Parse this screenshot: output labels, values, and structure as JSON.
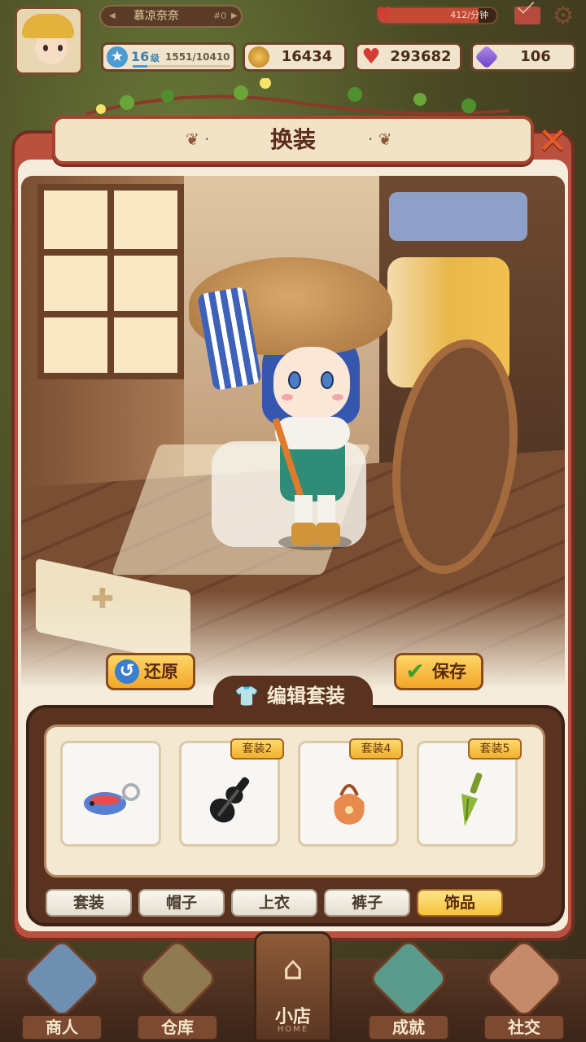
{
  "header": {
    "player_name": "慕凉奈奈",
    "player_uid": "#0",
    "energy_text": "412/分钟",
    "energy_fraction": 0.85,
    "level": "16",
    "level_unit": "级",
    "xp_text": "1551/10410",
    "xp_fraction": 0.149,
    "coins": "16434",
    "hearts": "293682",
    "gems": "106"
  },
  "panel": {
    "title": "换装",
    "close_icon": "close-icon"
  },
  "actions": {
    "reset_label": "还原",
    "save_label": "保存"
  },
  "editor": {
    "section_title": "编辑套装",
    "items": [
      {
        "name": "blue-fish-keychain",
        "badge": ""
      },
      {
        "name": "black-guitar-case",
        "badge": "套装2"
      },
      {
        "name": "orange-pouch",
        "badge": "套装4"
      },
      {
        "name": "green-trowel",
        "badge": "套装5"
      }
    ],
    "categories": [
      "套装",
      "帽子",
      "上衣",
      "裤子",
      "饰品"
    ],
    "active_category": "饰品"
  },
  "nav": {
    "merchant": "商人",
    "warehouse": "仓库",
    "shop": "小店",
    "shop_sub": "HOME",
    "achievement": "成就",
    "social": "社交"
  },
  "colors": {
    "panel_red": "#b9513e",
    "button_gold": "#f1a626",
    "tray_brown": "#5a3320",
    "energy_red": "#c44a35"
  }
}
